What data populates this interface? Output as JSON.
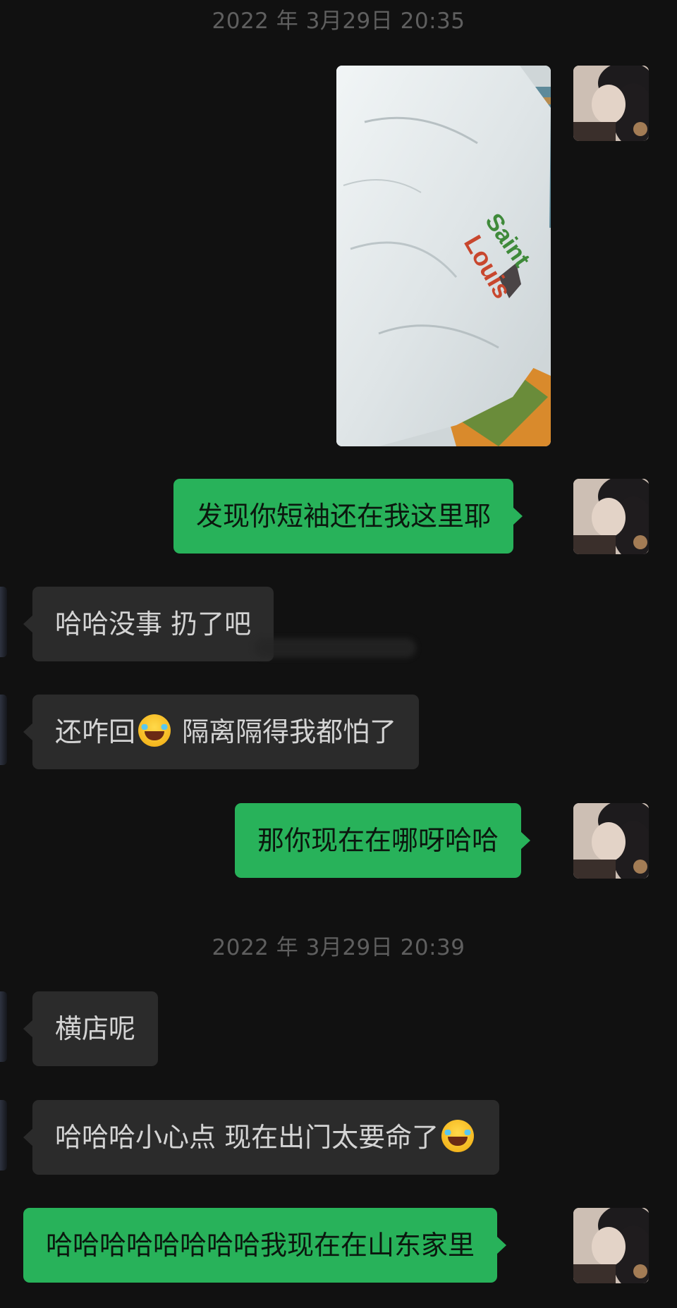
{
  "chat": {
    "timestamps": [
      "2022 年 3月29日 20:35",
      "2022 年 3月29日 20:39"
    ],
    "messages": [
      {
        "side": "out",
        "type": "image",
        "content": "Saint Louis"
      },
      {
        "side": "out",
        "type": "text",
        "text": "发现你短袖还在我这里耶"
      },
      {
        "side": "in",
        "type": "text",
        "text": "哈哈没事 扔了吧"
      },
      {
        "side": "in",
        "type": "text",
        "text_before": "还咋回",
        "emoji": "face-with-tears-of-joy",
        "text_after": " 隔离隔得我都怕了"
      },
      {
        "side": "out",
        "type": "text",
        "text": "那你现在在哪呀哈哈"
      },
      {
        "side": "in",
        "type": "text",
        "text": "横店呢"
      },
      {
        "side": "in",
        "type": "text",
        "text_before": "哈哈哈小心点 现在出门太要命了",
        "emoji": "face-with-tears-of-joy"
      },
      {
        "side": "out",
        "type": "text",
        "text": "哈哈哈哈哈哈哈哈我现在在山东家里"
      }
    ]
  },
  "photo": {
    "print_word_1": "Saint",
    "print_word_2": "Louis"
  },
  "colors": {
    "background": "#111111",
    "outgoing_bubble": "#28b25a",
    "incoming_bubble": "#2b2b2b",
    "timestamp_text": "#5f5f5f"
  },
  "icons": {
    "emoji": "face-with-tears-of-joy-icon",
    "avatar": "user-avatar"
  }
}
